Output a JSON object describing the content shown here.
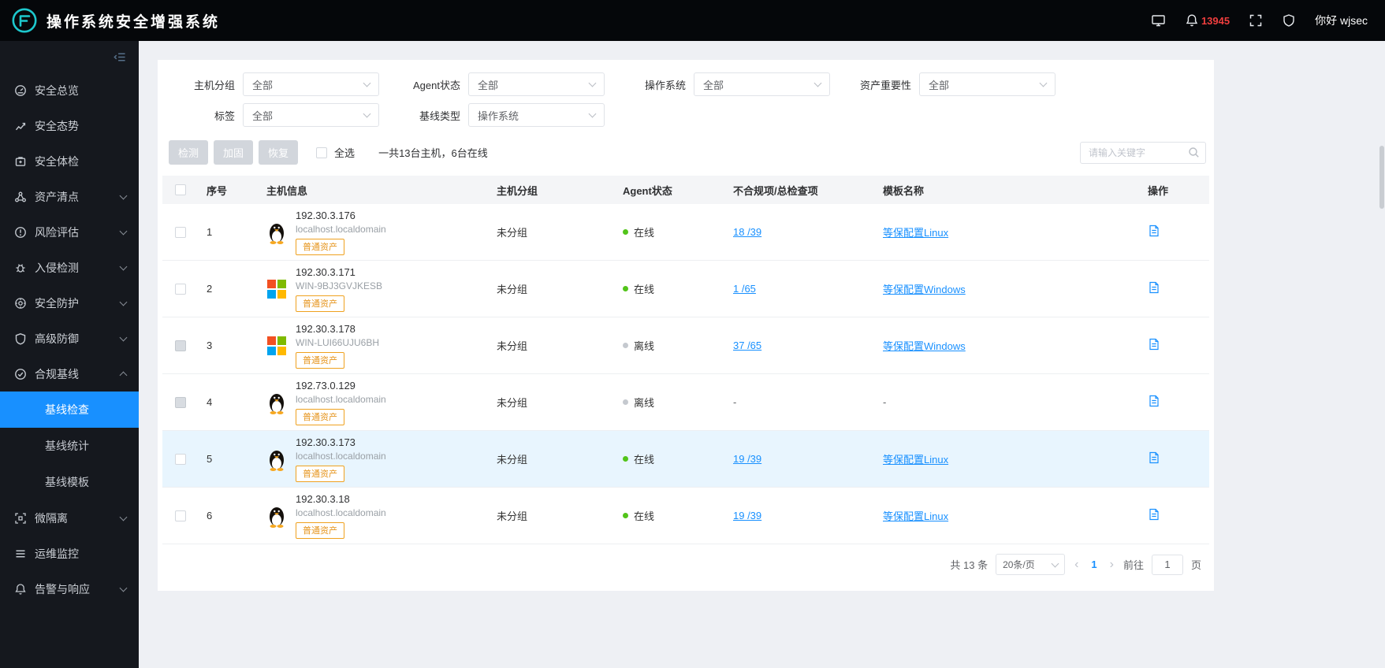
{
  "colors": {
    "accent": "#1890ff",
    "online_green": "#52c41a",
    "offline_gray": "#c5c9cf",
    "tag_orange": "#e6951e",
    "alert_red": "#f03e3e",
    "logo_teal": "#1dc8cd",
    "sidebar_bg": "#15181e",
    "topbar_bg": "#05070a"
  },
  "header": {
    "title": "操作系统安全增强系统",
    "notification_count": "13945",
    "greeting": "你好 wjsec"
  },
  "sidebar": {
    "items": [
      {
        "label": "安全总览"
      },
      {
        "label": "安全态势"
      },
      {
        "label": "安全体检"
      },
      {
        "label": "资产清点"
      },
      {
        "label": "风险评估"
      },
      {
        "label": "入侵检测"
      },
      {
        "label": "安全防护"
      },
      {
        "label": "高级防御"
      },
      {
        "label": "合规基线",
        "expanded": true,
        "children": [
          {
            "label": "基线检查",
            "active": true
          },
          {
            "label": "基线统计"
          },
          {
            "label": "基线模板"
          }
        ]
      },
      {
        "label": "微隔离"
      },
      {
        "label": "运维监控"
      },
      {
        "label": "告警与响应"
      }
    ]
  },
  "filters": {
    "host_group": {
      "label": "主机分组",
      "value": "全部"
    },
    "agent_status": {
      "label": "Agent状态",
      "value": "全部"
    },
    "os": {
      "label": "操作系统",
      "value": "全部"
    },
    "importance": {
      "label": "资产重要性",
      "value": "全部"
    },
    "tag": {
      "label": "标签",
      "value": "全部"
    },
    "baseline_type": {
      "label": "基线类型",
      "value": "操作系统"
    }
  },
  "toolbar": {
    "detect": "检测",
    "harden": "加固",
    "restore": "恢复",
    "select_all": "全选",
    "summary": "一共13台主机，6台在线",
    "search_placeholder": "请输入关键字"
  },
  "table": {
    "headers": [
      "序号",
      "主机信息",
      "主机分组",
      "Agent状态",
      "不合规项/总检查项",
      "模板名称",
      "操作"
    ],
    "rows": [
      {
        "index": "1",
        "os": "linux",
        "ip": "192.30.3.176",
        "hostname": "localhost.localdomain",
        "tag": "普通资产",
        "group": "未分组",
        "status": "online",
        "status_label": "在线",
        "result": "18 /39",
        "template": "等保配置Linux"
      },
      {
        "index": "2",
        "os": "windows",
        "ip": "192.30.3.171",
        "hostname": "WIN-9BJ3GVJKESB",
        "tag": "普通资产",
        "group": "未分组",
        "status": "online",
        "status_label": "在线",
        "result": "1 /65",
        "template": "等保配置Windows"
      },
      {
        "index": "3",
        "os": "windows",
        "ip": "192.30.3.178",
        "hostname": "WIN-LUI66UJU6BH",
        "tag": "普通资产",
        "group": "未分组",
        "status": "offline",
        "status_label": "离线",
        "result": "37 /65",
        "template": "等保配置Windows"
      },
      {
        "index": "4",
        "os": "linux",
        "ip": "192.73.0.129",
        "hostname": "localhost.localdomain",
        "tag": "普通资产",
        "group": "未分组",
        "status": "offline",
        "status_label": "离线",
        "result": "-",
        "template": "-"
      },
      {
        "index": "5",
        "os": "linux",
        "ip": "192.30.3.173",
        "hostname": "localhost.localdomain",
        "tag": "普通资产",
        "group": "未分组",
        "status": "online",
        "status_label": "在线",
        "result": "19 /39",
        "template": "等保配置Linux"
      },
      {
        "index": "6",
        "os": "linux",
        "ip": "192.30.3.18",
        "hostname": "localhost.localdomain",
        "tag": "普通资产",
        "group": "未分组",
        "status": "online",
        "status_label": "在线",
        "result": "19 /39",
        "template": "等保配置Linux"
      }
    ]
  },
  "pagination": {
    "total": "共 13 条",
    "page_size": "20条/页",
    "current_page": "1",
    "goto_label": "前往",
    "goto_value": "1",
    "page_unit": "页"
  }
}
